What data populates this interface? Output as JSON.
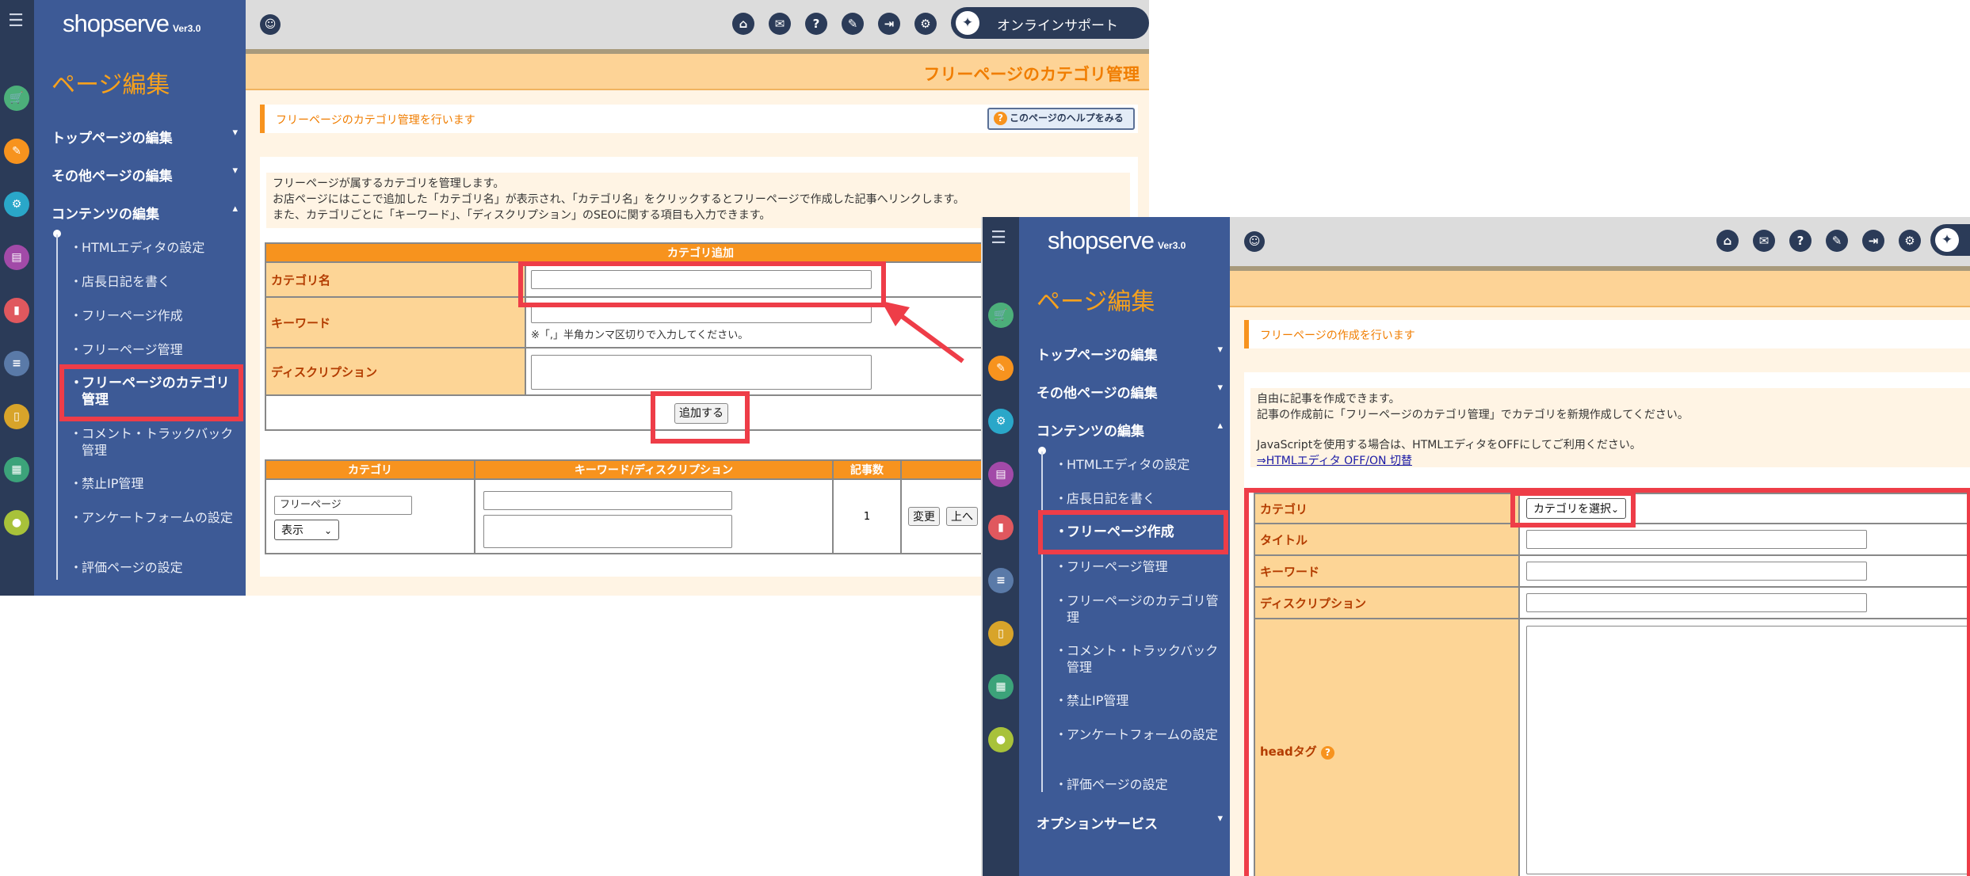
{
  "colors": {
    "accent": "#f7931e",
    "nav": "#3d5a96",
    "rail": "#2b3b58",
    "highlight": "#ee3d48"
  },
  "brand": {
    "name": "shopserve",
    "version": "Ver3.0"
  },
  "sidebar": {
    "section_title": "ページ編集",
    "top_page": "トップページの編集",
    "other_pages": "その他ページの編集",
    "contents": "コンテンツの編集",
    "items": [
      "HTMLエディタの設定",
      "店長日記を書く",
      "フリーページ作成",
      "フリーページ管理",
      "フリーページのカテゴリ管理",
      "コメント・トラックバック管理",
      "禁止IP管理",
      "アンケートフォームの設定",
      "評価ページの設定"
    ],
    "option_service": "オプションサービス"
  },
  "rail_icons": [
    "menu-toggle-icon",
    "cart-icon",
    "edit-icon",
    "gear-icon",
    "layout-icon",
    "chart-icon",
    "server-icon",
    "mobile-icon",
    "clipboard-icon",
    "users-icon"
  ],
  "topbar": {
    "icons": [
      "shop-icon",
      "mail-icon",
      "help-icon",
      "chat-icon",
      "logout-icon",
      "settings-icon"
    ],
    "support_label": "オンラインサポート"
  },
  "screen1": {
    "page_title": "フリーページのカテゴリ管理",
    "notice": "フリーページのカテゴリ管理を行います",
    "help_button": "このページのヘルプをみる",
    "description": [
      "フリーページが属するカテゴリを管理します。",
      "お店ページにはここで追加した「カテゴリ名」が表示され、「カテゴリ名」をクリックするとフリーページで作成した記事へリンクします。",
      "また、カテゴリごとに「キーワード」、「ディスクリプション」のSEOに関する項目も入力できます。"
    ],
    "add_form": {
      "header": "カテゴリ追加",
      "category_label": "カテゴリ名",
      "keyword_label": "キーワード",
      "keyword_hint": "※「,」半角カンマ区切りで入力してください。",
      "description_label": "ディスクリプション",
      "submit": "追加する"
    },
    "list": {
      "headers": [
        "カテゴリ",
        "キーワード/ディスクリプション",
        "記事数",
        ""
      ],
      "row": {
        "category": "フリーページ",
        "visibility": "表示",
        "count": "1",
        "change": "変更",
        "up": "上へ"
      }
    }
  },
  "screen2": {
    "notice": "フリーページの作成を行います",
    "description": [
      "自由に記事を作成できます。",
      "記事の作成前に「フリーページのカテゴリ管理」でカテゴリを新規作成してください。",
      "JavaScriptを使用する場合は、HTMLエディタをOFFにしてご利用ください。"
    ],
    "editor_toggle": "⇒HTMLエディタ OFF/ON 切替",
    "form": {
      "category_label": "カテゴリ",
      "category_select": "カテゴリを選択",
      "title_label": "タイトル",
      "keyword_label": "キーワード",
      "description_label": "ディスクリプション",
      "head_label": "headタグ"
    }
  }
}
